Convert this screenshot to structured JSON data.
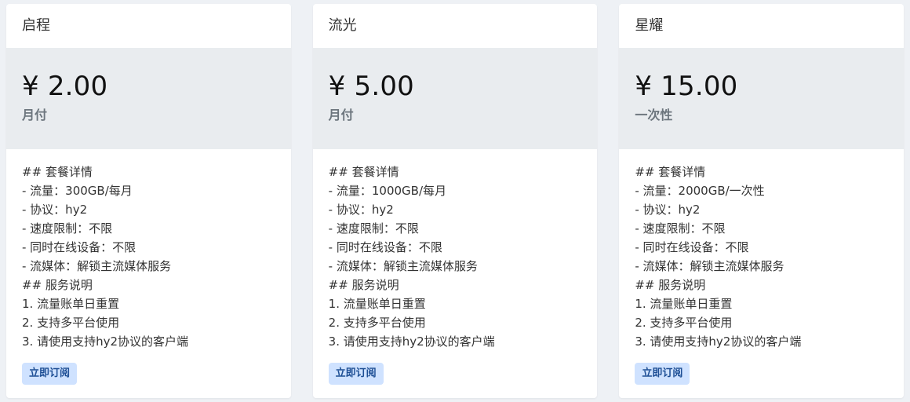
{
  "plans": [
    {
      "name": "启程",
      "price": "¥ 2.00",
      "period": "月付",
      "details": [
        "## 套餐详情",
        "- 流量：300GB/每月",
        "- 协议：hy2",
        "- 速度限制：不限",
        "- 同时在线设备：不限",
        "- 流媒体：解锁主流媒体服务",
        "## 服务说明",
        "1. 流量账单日重置",
        "2. 支持多平台使用",
        "3. 请使用支持hy2协议的客户端"
      ],
      "button_label": "立即订阅"
    },
    {
      "name": "流光",
      "price": "¥ 5.00",
      "period": "月付",
      "details": [
        "## 套餐详情",
        "- 流量：1000GB/每月",
        "- 协议：hy2",
        "- 速度限制：不限",
        "- 同时在线设备：不限",
        "- 流媒体：解锁主流媒体服务",
        "## 服务说明",
        "1. 流量账单日重置",
        "2. 支持多平台使用",
        "3. 请使用支持hy2协议的客户端"
      ],
      "button_label": "立即订阅"
    },
    {
      "name": "星耀",
      "price": "¥ 15.00",
      "period": "一次性",
      "details": [
        "## 套餐详情",
        "- 流量：2000GB/一次性",
        "- 协议：hy2",
        "- 速度限制：不限",
        "- 同时在线设备：不限",
        "- 流媒体：解锁主流媒体服务",
        "## 服务说明",
        "1. 流量账单日重置",
        "2. 支持多平台使用",
        "3. 请使用支持hy2协议的客户端"
      ],
      "button_label": "立即订阅"
    }
  ],
  "colors": {
    "page_background": "#eef1f5",
    "card_background": "#ffffff",
    "price_background": "#e9ecef",
    "button_background": "#cfe2ff",
    "button_text": "#1e4f95"
  }
}
